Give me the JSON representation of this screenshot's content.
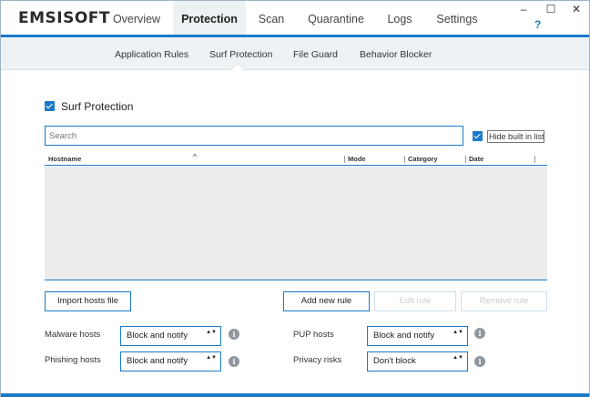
{
  "app": {
    "logo": "EMSISOFT"
  },
  "main_tabs": [
    {
      "label": "Overview"
    },
    {
      "label": "Protection"
    },
    {
      "label": "Scan"
    },
    {
      "label": "Quarantine"
    },
    {
      "label": "Logs"
    },
    {
      "label": "Settings"
    }
  ],
  "active_main_tab": "Protection",
  "window_controls": {
    "minimize": "–",
    "maximize": "☐",
    "close": "✕",
    "help": "?"
  },
  "sub_tabs": [
    {
      "label": "Application Rules"
    },
    {
      "label": "Surf Protection"
    },
    {
      "label": "File Guard"
    },
    {
      "label": "Behavior Blocker"
    }
  ],
  "active_sub_tab": "Surf Protection",
  "surf_protection": {
    "label": "Surf Protection",
    "enabled": true
  },
  "search": {
    "placeholder": "Search",
    "value": ""
  },
  "hide_builtin": {
    "label": "Hide built in list",
    "checked": true
  },
  "table": {
    "columns": [
      "Hostname",
      "Mode",
      "Category",
      "Date"
    ],
    "sort_indicator": "^",
    "rows": []
  },
  "buttons": {
    "import": "Import hosts file",
    "add": "Add new rule",
    "edit": "Edit rule",
    "remove": "Remove rule"
  },
  "options": {
    "malware": {
      "label": "Malware hosts",
      "value": "Block and notify"
    },
    "phishing": {
      "label": "Phishing hosts",
      "value": "Block and notify"
    },
    "pup": {
      "label": "PUP hosts",
      "value": "Block and notify"
    },
    "privacy": {
      "label": "Privacy risks",
      "value": "Don't block"
    }
  },
  "select_arrows": "▲▼",
  "info_glyph": "i",
  "colors": {
    "accent": "#1a7ac8",
    "subnav_bg": "#eef2f5",
    "table_bg": "#ececec"
  }
}
